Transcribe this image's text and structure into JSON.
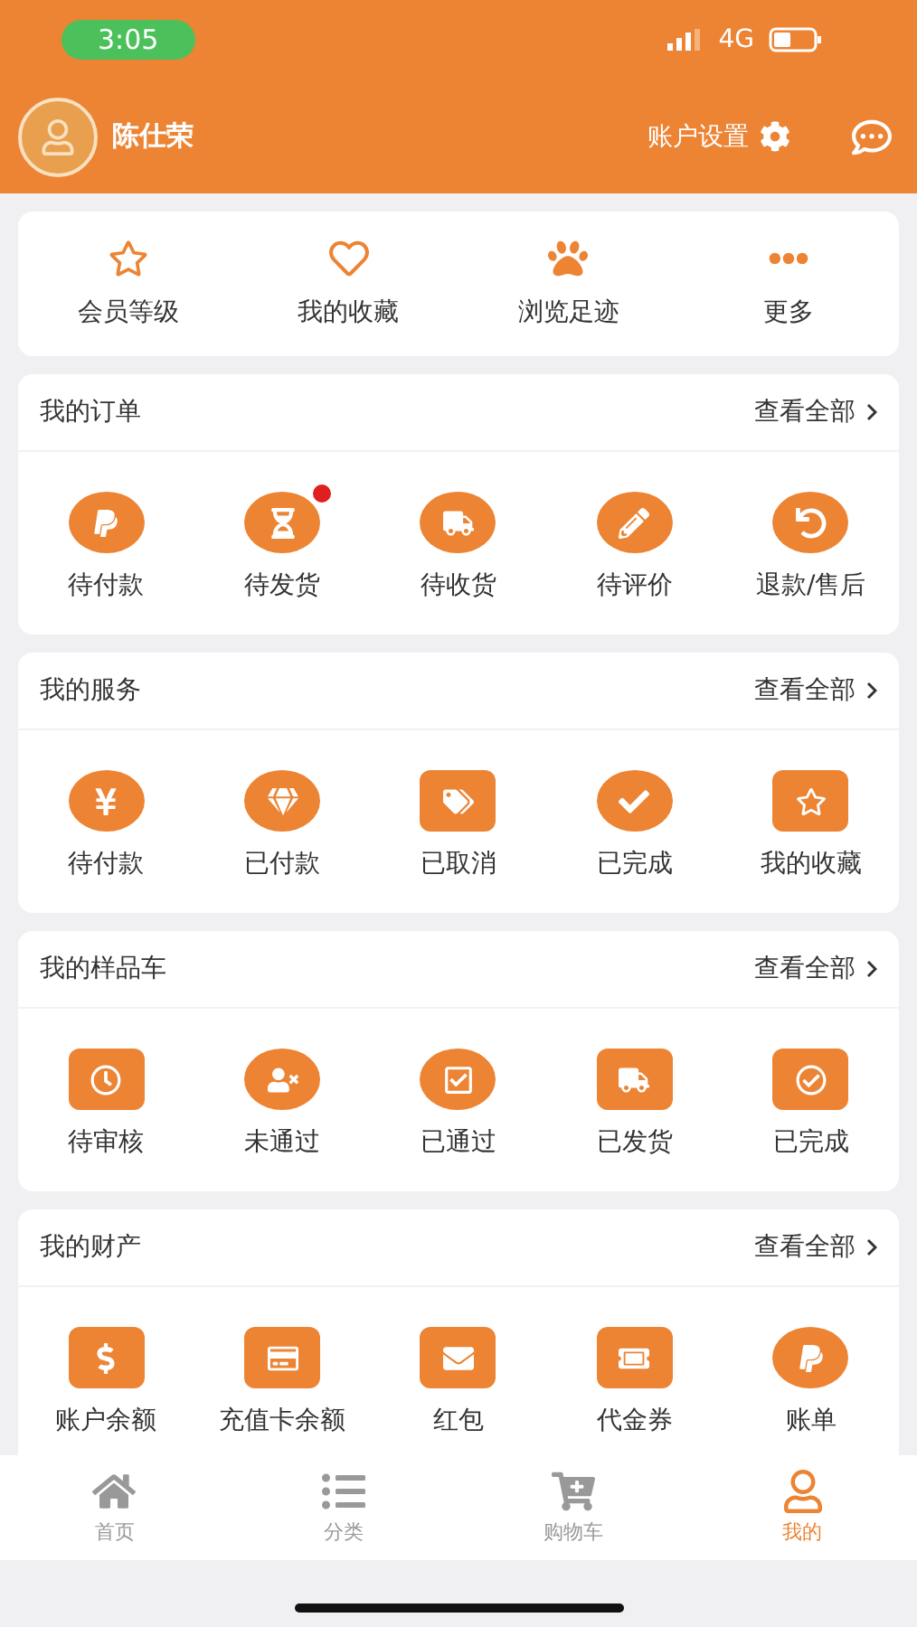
{
  "status_bar": {
    "time": "3:05",
    "network": "4G"
  },
  "header": {
    "user_name": "陈仕荣",
    "settings_label": "账户设置"
  },
  "quick_links": [
    {
      "label": "会员等级"
    },
    {
      "label": "我的收藏"
    },
    {
      "label": "浏览足迹"
    },
    {
      "label": "更多"
    }
  ],
  "sections": [
    {
      "title": "我的订单",
      "view_all": "查看全部",
      "items": [
        {
          "label": "待付款",
          "kind": "circle",
          "dot": false
        },
        {
          "label": "待发货",
          "kind": "circle",
          "dot": true
        },
        {
          "label": "待收货",
          "kind": "circle",
          "dot": false
        },
        {
          "label": "待评价",
          "kind": "circle",
          "dot": false
        },
        {
          "label": "退款/售后",
          "kind": "circle",
          "dot": false
        }
      ]
    },
    {
      "title": "我的服务",
      "view_all": "查看全部",
      "items": [
        {
          "label": "待付款",
          "kind": "circle",
          "dot": false
        },
        {
          "label": "已付款",
          "kind": "circle",
          "dot": false
        },
        {
          "label": "已取消",
          "kind": "square",
          "dot": false
        },
        {
          "label": "已完成",
          "kind": "circle",
          "dot": false
        },
        {
          "label": "我的收藏",
          "kind": "square",
          "dot": false
        }
      ]
    },
    {
      "title": "我的样品车",
      "view_all": "查看全部",
      "items": [
        {
          "label": "待审核",
          "kind": "square",
          "dot": false
        },
        {
          "label": "未通过",
          "kind": "circle",
          "dot": false
        },
        {
          "label": "已通过",
          "kind": "circle",
          "dot": false
        },
        {
          "label": "已发货",
          "kind": "square",
          "dot": false
        },
        {
          "label": "已完成",
          "kind": "square",
          "dot": false
        }
      ]
    },
    {
      "title": "我的财产",
      "view_all": "查看全部",
      "items": [
        {
          "label": "账户余额",
          "kind": "square",
          "dot": false
        },
        {
          "label": "充值卡余额",
          "kind": "square",
          "dot": false
        },
        {
          "label": "红包",
          "kind": "square",
          "dot": false
        },
        {
          "label": "代金券",
          "kind": "square",
          "dot": false
        },
        {
          "label": "账单",
          "kind": "circle",
          "dot": false
        }
      ]
    }
  ],
  "tab_bar": [
    {
      "label": "首页",
      "selected": false
    },
    {
      "label": "分类",
      "selected": false
    },
    {
      "label": "购物车",
      "selected": false
    },
    {
      "label": "我的",
      "selected": true
    }
  ]
}
